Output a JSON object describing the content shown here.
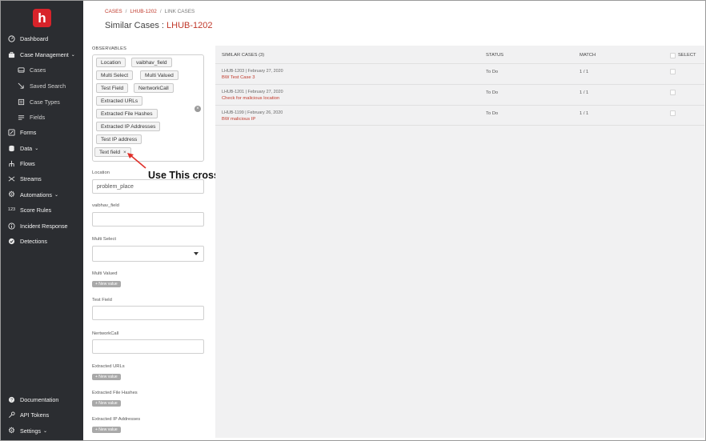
{
  "sidebar": {
    "logo": "h",
    "items": [
      {
        "label": "Dashboard",
        "icon": "dashboard-icon"
      },
      {
        "label": "Case Management",
        "icon": "case-management-icon",
        "chevron": "⌄"
      },
      {
        "label": "Cases",
        "icon": "inbox-icon"
      },
      {
        "label": "Saved Search",
        "icon": "saved-search-icon"
      },
      {
        "label": "Case Types",
        "icon": "case-types-icon"
      },
      {
        "label": "Fields",
        "icon": "fields-icon"
      },
      {
        "label": "Forms",
        "icon": "forms-icon"
      },
      {
        "label": "Data",
        "icon": "database-icon",
        "chevron": "⌄"
      },
      {
        "label": "Flows",
        "icon": "flows-icon"
      },
      {
        "label": "Streams",
        "icon": "streams-icon"
      },
      {
        "label": "Automations",
        "icon": "gear-icon",
        "chevron": "⌄"
      },
      {
        "label": "Score Rules",
        "icon": "score-rules-icon",
        "glyph": "123"
      },
      {
        "label": "Incident Response",
        "icon": "info-icon"
      },
      {
        "label": "Detections",
        "icon": "detections-icon"
      },
      {
        "label": "Documentation",
        "icon": "help-icon"
      },
      {
        "label": "API Tokens",
        "icon": "key-icon"
      },
      {
        "label": "Settings",
        "icon": "settings-icon",
        "chevron": "⌄"
      }
    ]
  },
  "breadcrumb": {
    "cases": "CASES",
    "case": "LHUB-1202",
    "current": "LINK CASES",
    "sep": "/"
  },
  "title": {
    "prefix": "Similar Cases :",
    "case_id": "LHUB-1202"
  },
  "observables": {
    "label": "OBSERVABLES",
    "tags": [
      "Location",
      "vaibhav_field",
      "Multi Select",
      "Multi Valued",
      "Test Field",
      "NertworkCall",
      "Extracted URLs",
      "Extracted File Hashes",
      "Extracted IP Addresses",
      "Test IP address",
      "Text field"
    ],
    "remove_glyph": "×"
  },
  "form": {
    "location_label": "Location",
    "location_value": "problem_place",
    "vaibhav_label": "vaibhav_field",
    "multi_select_label": "Multi Select",
    "multi_valued_label": "Multi Valued",
    "test_field_label": "Test Field",
    "network_label": "NertworkCall",
    "urls_label": "Extracted URLs",
    "hashes_label": "Extracted File Hashes",
    "ips_label": "Extracted IP Addresses",
    "new_value": "+ New value"
  },
  "annotation": {
    "text": "Use This cross",
    "color": "#e0302a"
  },
  "table": {
    "headers": {
      "similar": "SIMILAR CASES (3)",
      "status": "STATUS",
      "match": "MATCH",
      "select": "SELECT"
    },
    "rows": [
      {
        "meta": "LHUB-1203 | February 27, 2020",
        "title": "BW Test Case 3",
        "status": "To Do",
        "match": "1 / 1"
      },
      {
        "meta": "LHUB-1201 | February 27, 2020",
        "title": "Check for malicious location",
        "status": "To Do",
        "match": "1 / 1"
      },
      {
        "meta": "LHUB-1199 | February 26, 2020",
        "title": "BW malicious IP",
        "status": "To Do",
        "match": "1 / 1"
      }
    ]
  },
  "colors": {
    "accent": "#c0392b",
    "sidebar_bg": "#2b2d31",
    "logo": "#d8232a"
  }
}
